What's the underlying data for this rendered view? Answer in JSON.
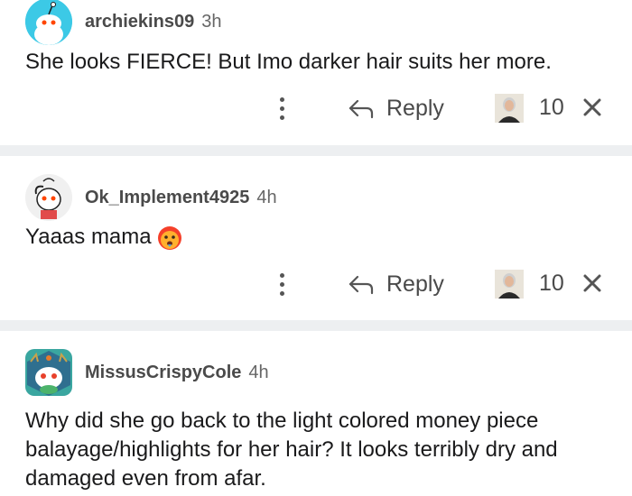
{
  "comments": [
    {
      "username": "archiekins09",
      "time": "3h",
      "text": "She looks FIERCE! But Imo darker hair suits her more.",
      "reply_label": "Reply",
      "award_count": "10",
      "avatar_color": "#3cc9e6"
    },
    {
      "username": "Ok_Implement4925",
      "time": "4h",
      "text": "Yaaas mama",
      "reply_label": "Reply",
      "award_count": "10",
      "avatar_color": "#f2f2f2"
    },
    {
      "username": "MissusCrispyCole",
      "time": "4h",
      "text": "Why did she go back to the light colored money piece balayage/highlights for her hair? It looks terribly dry and damaged even from afar.",
      "avatar_color": "#3aa6a0"
    }
  ],
  "icons": {
    "more": "more-vertical-icon",
    "reply": "reply-arrow-icon",
    "award": "award-icon",
    "close": "close-icon",
    "emoji": "hot-face-emoji-icon"
  },
  "colors": {
    "text": "#1a1a1b",
    "meta": "#4a4a4a",
    "divider": "#edeff1"
  }
}
